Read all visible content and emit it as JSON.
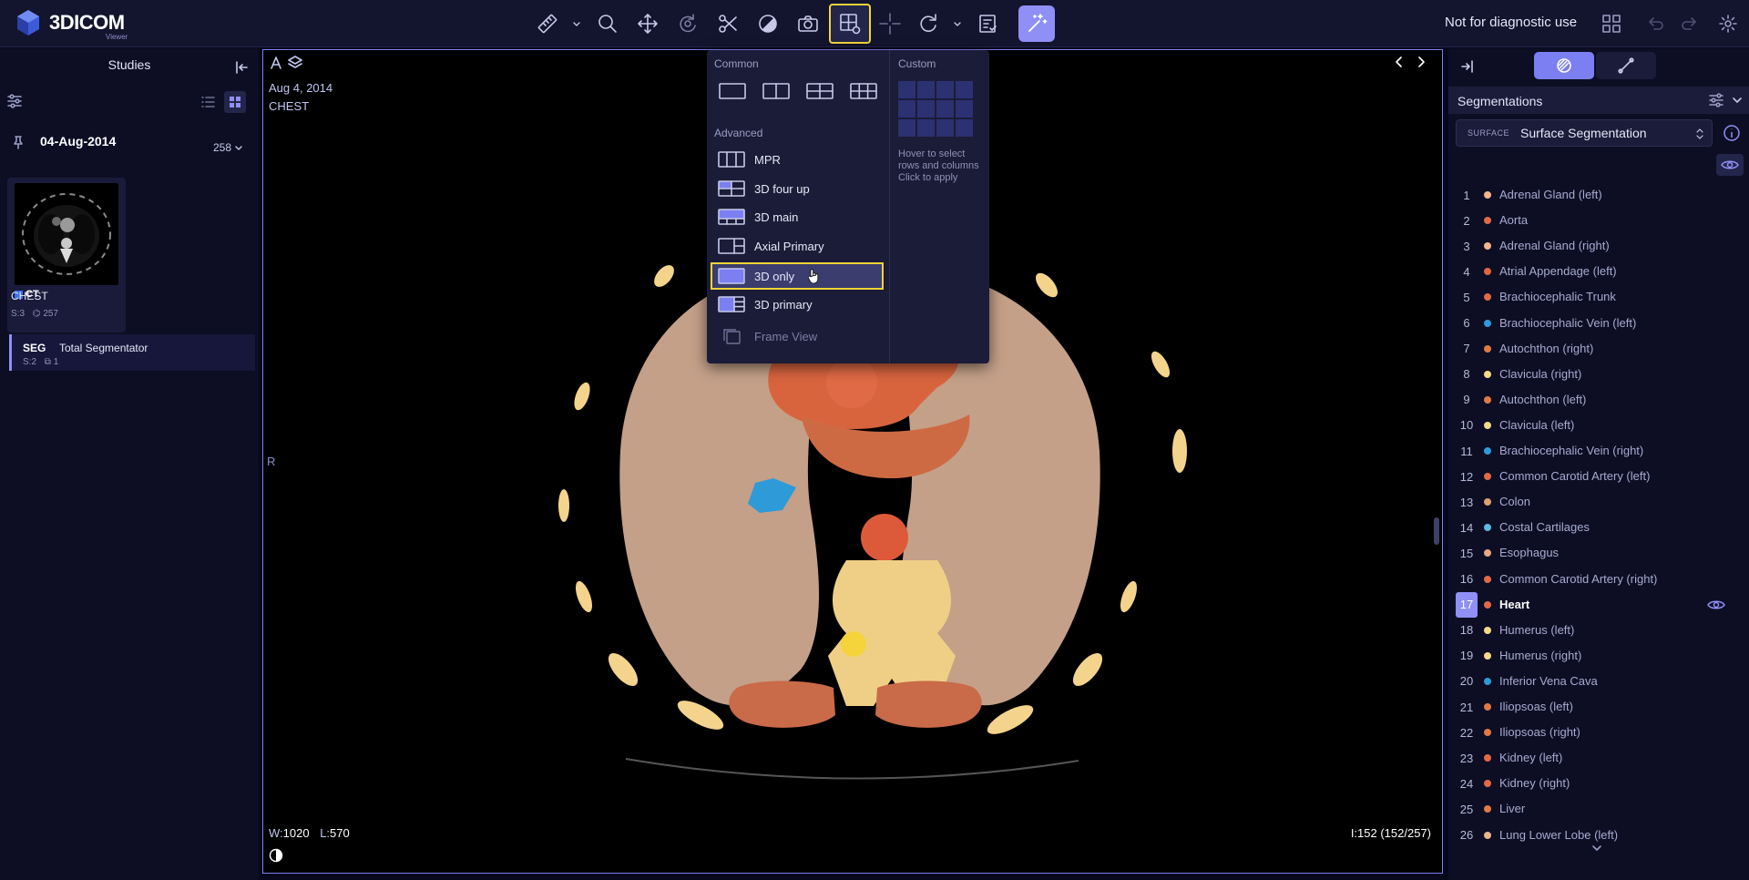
{
  "app": {
    "brand": "3DICOM",
    "brand_sub": "Viewer",
    "notice": "Not for diagnostic use"
  },
  "toolbar": {
    "tools": [
      "ruler-icon",
      "caret-down-icon",
      "magnifier-icon",
      "pan-icon",
      "rotate-3d-icon",
      "scissors-icon",
      "contrast-icon",
      "camera-icon",
      "layout-icon",
      "crosshair-icon",
      "reset-icon",
      "caret-down-icon",
      "report-icon",
      "magic-wand-icon"
    ]
  },
  "studies": {
    "title": "Studies",
    "date": "04-Aug-2014",
    "count": "258",
    "series": {
      "modality": "CT",
      "name": "CHEST",
      "meta_s": "S:3",
      "meta_n": "257"
    },
    "seg": {
      "modality": "SEG",
      "name": "Total Segmentator",
      "meta_s": "S:2",
      "meta_n": "1"
    }
  },
  "viewport": {
    "date": "Aug 4, 2014",
    "series": "CHEST",
    "orientation": "R",
    "window_label": "W:",
    "window": "1020",
    "level_label": "L:",
    "level": "570",
    "image_index": "I:152 (152/257)"
  },
  "layout_menu": {
    "common_label": "Common",
    "advanced_label": "Advanced",
    "custom_label": "Custom",
    "advanced": [
      {
        "label": "MPR"
      },
      {
        "label": "3D four up"
      },
      {
        "label": "3D main"
      },
      {
        "label": "Axial Primary"
      },
      {
        "label": "3D only"
      },
      {
        "label": "3D primary"
      },
      {
        "label": "Frame View"
      }
    ],
    "custom_hint": "Hover to select rows and columns Click to apply"
  },
  "segmentations": {
    "title": "Segmentations",
    "surface_prefix": "SURFACE",
    "surface_value": "Surface Segmentation",
    "active_index": 17,
    "items": [
      {
        "n": "1",
        "name": "Adrenal Gland (left)",
        "color": "#f3b58e"
      },
      {
        "n": "2",
        "name": "Aorta",
        "color": "#e06a45"
      },
      {
        "n": "3",
        "name": "Adrenal Gland (right)",
        "color": "#f3b58e"
      },
      {
        "n": "4",
        "name": "Atrial Appendage (left)",
        "color": "#e0663f"
      },
      {
        "n": "5",
        "name": "Brachiocephalic Trunk",
        "color": "#e06a45"
      },
      {
        "n": "6",
        "name": "Brachiocephalic Vein (left)",
        "color": "#2f9ad8"
      },
      {
        "n": "7",
        "name": "Autochthon (right)",
        "color": "#e07a45"
      },
      {
        "n": "8",
        "name": "Clavicula (right)",
        "color": "#f5d98a"
      },
      {
        "n": "9",
        "name": "Autochthon (left)",
        "color": "#e07a45"
      },
      {
        "n": "10",
        "name": "Clavicula (left)",
        "color": "#f5d98a"
      },
      {
        "n": "11",
        "name": "Brachiocephalic Vein (right)",
        "color": "#2f9ad8"
      },
      {
        "n": "12",
        "name": "Common Carotid Artery (left)",
        "color": "#e06a45"
      },
      {
        "n": "13",
        "name": "Colon",
        "color": "#e0a070"
      },
      {
        "n": "14",
        "name": "Costal Cartilages",
        "color": "#5fb8e0"
      },
      {
        "n": "15",
        "name": "Esophagus",
        "color": "#e8a882"
      },
      {
        "n": "16",
        "name": "Common Carotid Artery (right)",
        "color": "#e06a45"
      },
      {
        "n": "17",
        "name": "Heart",
        "color": "#e06a45"
      },
      {
        "n": "18",
        "name": "Humerus (left)",
        "color": "#f5d98a"
      },
      {
        "n": "19",
        "name": "Humerus (right)",
        "color": "#f5d98a"
      },
      {
        "n": "20",
        "name": "Inferior Vena Cava",
        "color": "#2f9ad8"
      },
      {
        "n": "21",
        "name": "Iliopsoas (left)",
        "color": "#e07a45"
      },
      {
        "n": "22",
        "name": "Iliopsoas (right)",
        "color": "#e07a45"
      },
      {
        "n": "23",
        "name": "Kidney (left)",
        "color": "#e06a45"
      },
      {
        "n": "24",
        "name": "Kidney (right)",
        "color": "#e06a45"
      },
      {
        "n": "25",
        "name": "Liver",
        "color": "#e07a45"
      },
      {
        "n": "26",
        "name": "Lung Lower Lobe (left)",
        "color": "#e8b58e"
      }
    ]
  },
  "colors": {
    "accent": "#8f8ff5",
    "highlight": "#f5d33a",
    "panel": "#0d0e24"
  }
}
